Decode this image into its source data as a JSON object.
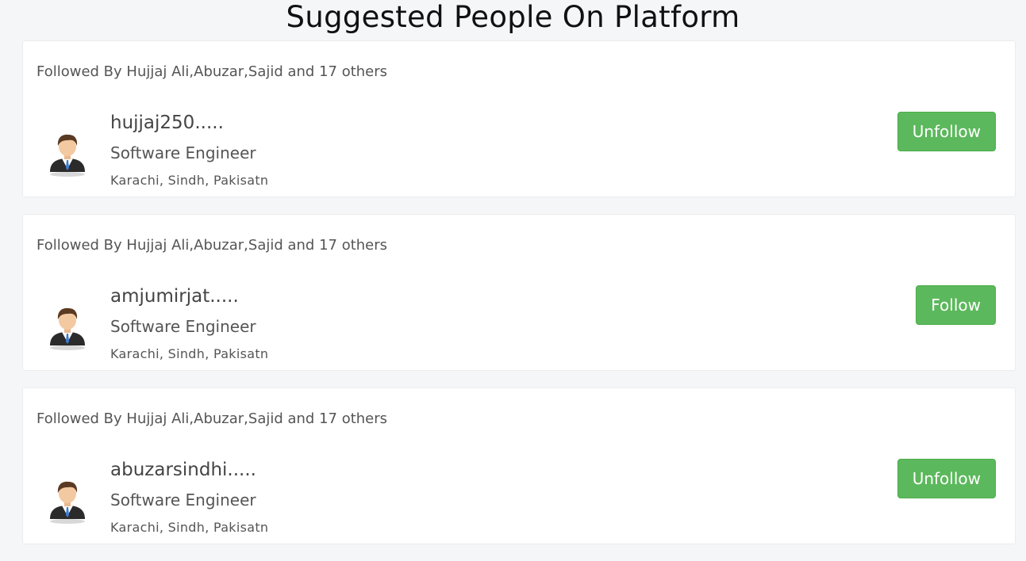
{
  "page": {
    "title": "Suggested People On Platform"
  },
  "people": [
    {
      "followed_by": "Followed By Hujjaj Ali,Abuzar,Sajid and 17 others",
      "username": "hujjaj250.....",
      "job_title": "Software Engineer",
      "location": "Karachi, Sindh, Pakisatn",
      "button_label": "Unfollow"
    },
    {
      "followed_by": "Followed By Hujjaj Ali,Abuzar,Sajid and 17 others",
      "username": "amjumirjat.....",
      "job_title": "Software Engineer",
      "location": "Karachi, Sindh, Pakisatn",
      "button_label": "Follow"
    },
    {
      "followed_by": "Followed By Hujjaj Ali,Abuzar,Sajid and 17 others",
      "username": "abuzarsindhi.....",
      "job_title": "Software Engineer",
      "location": "Karachi, Sindh, Pakisatn",
      "button_label": "Unfollow"
    }
  ],
  "colors": {
    "button_bg": "#5cb85c",
    "page_bg": "#f5f6f8",
    "card_bg": "#ffffff"
  },
  "icons": {
    "avatar": "businessman-avatar-icon"
  }
}
